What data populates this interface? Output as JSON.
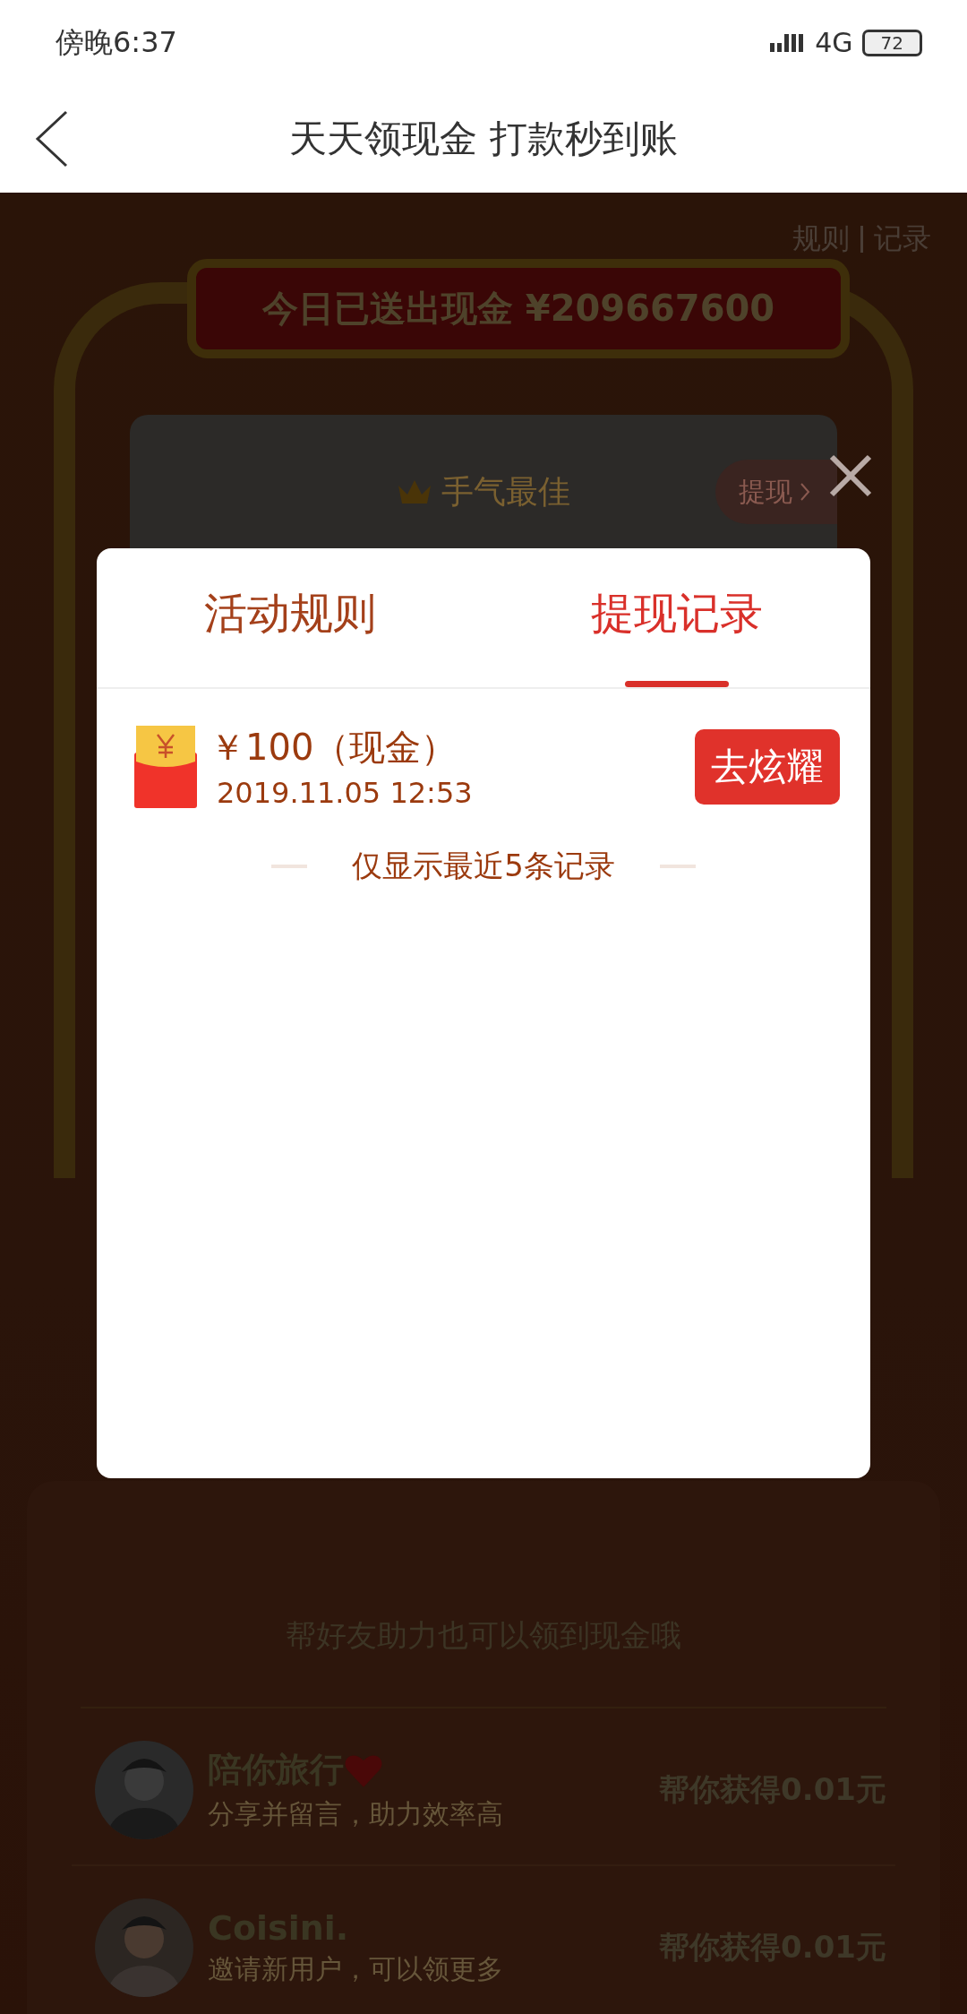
{
  "status_bar": {
    "time": "傍晚6:37",
    "network": "4G",
    "battery": "72"
  },
  "nav": {
    "title": "天天领现金 打款秒到账"
  },
  "page": {
    "links": [
      {
        "label": "规则"
      },
      {
        "label": "记录"
      }
    ],
    "banner": "今日已送出现金 ¥209667600",
    "card": {
      "title": "手气最佳",
      "withdraw": "提现"
    },
    "helper_hint": "帮好友助力也可以领到现金哦",
    "friends": [
      {
        "name": "陪你旅行",
        "heart": true,
        "note": "分享并留言，助力效率高",
        "reward": "帮你获得0.01元"
      },
      {
        "name": "Coisini.",
        "heart": false,
        "note": "邀请新用户，可以领更多",
        "reward": "帮你获得0.01元"
      }
    ]
  },
  "dialog": {
    "tabs": [
      {
        "label": "活动规则",
        "selected": false
      },
      {
        "label": "提现记录",
        "selected": true
      }
    ],
    "records": [
      {
        "amount": "￥100（现金）",
        "time": "2019.11.05 12:53",
        "action": "去炫耀"
      }
    ],
    "footnote": "仅显示最近5条记录"
  }
}
